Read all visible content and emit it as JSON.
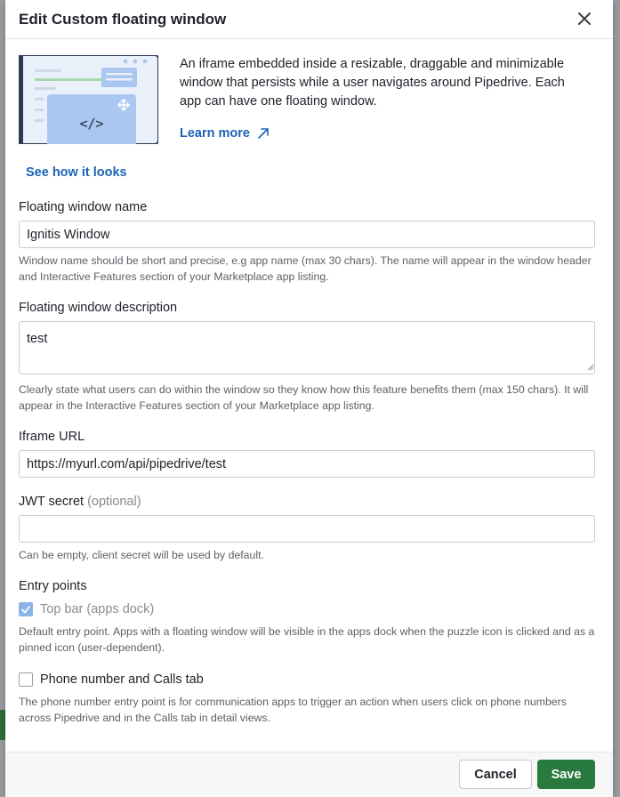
{
  "modal": {
    "title": "Edit Custom floating window"
  },
  "intro": {
    "description": "An iframe embedded inside a resizable, draggable and minimizable window that persists while a user navigates around Pipedrive. Each app can have one floating window.",
    "learn_more": "Learn more",
    "see_how": "See how it looks",
    "illustration_code": "</>"
  },
  "fields": {
    "name": {
      "label": "Floating window name",
      "value": "Ignitis Window",
      "hint": "Window name should be short and precise, e.g app name (max 30 chars). The name will appear in the window header and Interactive Features section of your Marketplace app listing."
    },
    "description": {
      "label": "Floating window description",
      "value": "test",
      "hint": "Clearly state what users can do within the window so they know how this feature benefits them (max 150 chars). It will appear in the Interactive Features section of your Marketplace app listing."
    },
    "iframe_url": {
      "label": "Iframe URL",
      "value": "https://myurl.com/api/pipedrive/test"
    },
    "jwt": {
      "label": "JWT secret",
      "optional": "(optional)",
      "value": "",
      "hint": "Can be empty, client secret will be used by default."
    }
  },
  "entry_points": {
    "label": "Entry points",
    "top_bar": {
      "label": "Top bar (apps dock)",
      "checked": true,
      "disabled": true,
      "hint": "Default entry point. Apps with a floating window will be visible in the apps dock when the puzzle icon is clicked and as a pinned icon (user-dependent)."
    },
    "phone": {
      "label": "Phone number and Calls tab",
      "checked": false,
      "hint": "The phone number entry point is for communication apps to trigger an action when users click on phone numbers across Pipedrive and in the Calls tab in detail views."
    }
  },
  "footer": {
    "cancel": "Cancel",
    "save": "Save"
  },
  "colors": {
    "link": "#1b63b5",
    "save": "#287a3e",
    "checkbox_checked": "#8ab4e6",
    "illustration_bg": "#e9f0fa",
    "illustration_window": "#a9c7f0"
  },
  "icons": {
    "close": "close-icon",
    "external_link": "arrow-up-right-icon",
    "move": "move-icon",
    "check": "check-icon"
  }
}
